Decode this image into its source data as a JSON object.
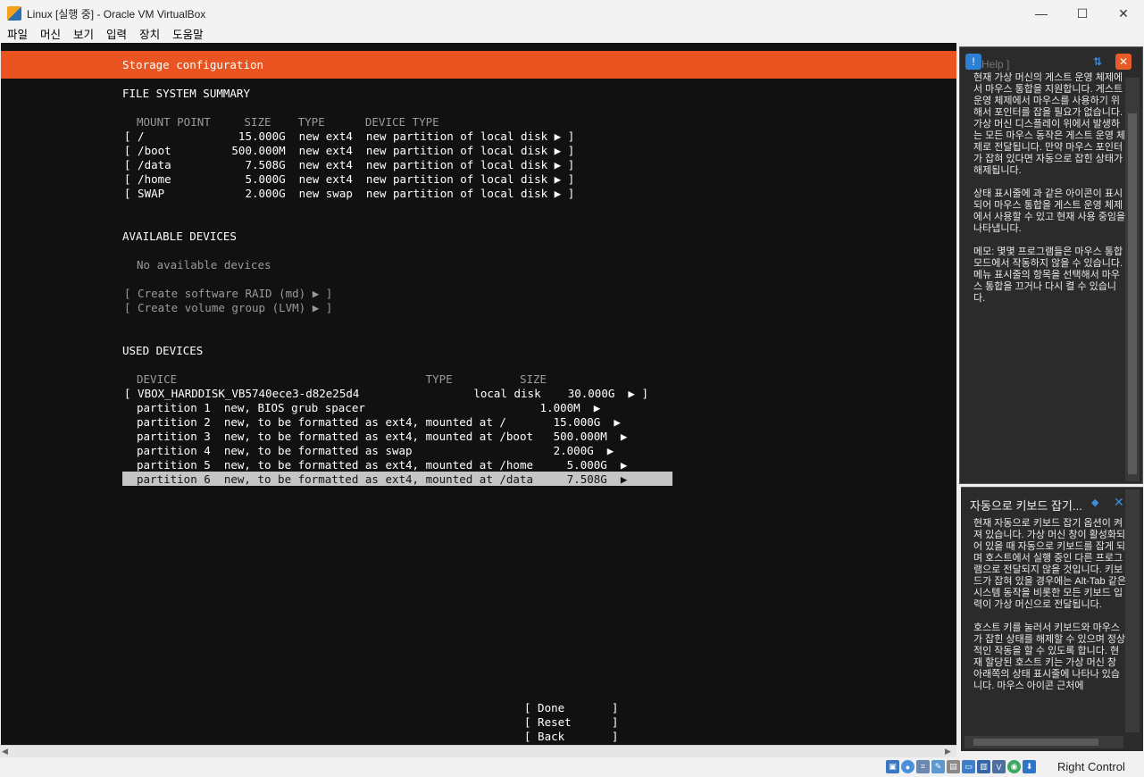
{
  "window": {
    "title": "Linux [실행 중] - Oracle VM VirtualBox",
    "min": "—",
    "max": "☐",
    "close": "✕"
  },
  "menu": [
    "파일",
    "머신",
    "보기",
    "입력",
    "장치",
    "도움말"
  ],
  "vm": {
    "header": "Storage configuration",
    "fs_summary_title": "FILE SYSTEM SUMMARY",
    "fs_header": "MOUNT POINT     SIZE    TYPE      DEVICE TYPE",
    "fs_rows": [
      "[ /              15.000G  new ext4  new partition of local disk ▶ ]",
      "[ /boot         500.000M  new ext4  new partition of local disk ▶ ]",
      "[ /data           7.508G  new ext4  new partition of local disk ▶ ]",
      "[ /home           5.000G  new ext4  new partition of local disk ▶ ]",
      "[ SWAP            2.000G  new swap  new partition of local disk ▶ ]"
    ],
    "available_title": "AVAILABLE DEVICES",
    "no_devices": "No available devices",
    "create_raid": "[ Create software RAID (md) ▶ ]",
    "create_lvm": "[ Create volume group (LVM) ▶ ]",
    "used_title": "USED DEVICES",
    "used_header": "DEVICE                                     TYPE          SIZE",
    "used_disk": "[ VBOX_HARDDISK_VB5740ece3-d82e25d4                 local disk    30.000G  ▶ ]",
    "partitions": [
      "partition 1  new, BIOS grub spacer                          1.000M  ▶",
      "partition 2  new, to be formatted as ext4, mounted at /       15.000G  ▶",
      "partition 3  new, to be formatted as ext4, mounted at /boot   500.000M  ▶",
      "partition 4  new, to be formatted as swap                     2.000G  ▶",
      "partition 5  new, to be formatted as ext4, mounted at /home     5.000G  ▶",
      "partition 6  new, to be formatted as ext4, mounted at /data     7.508G  ▶"
    ],
    "btn_done": "[ Done       ]",
    "btn_reset": "[ Reset      ]",
    "btn_back": "[ Back       ]"
  },
  "help_panel": {
    "label": "Help ]",
    "paragraphs": [
      "현재 가상 머신의 게스트 운영 체제에서 마우스 통합을 지원합니다. 게스트 운영 체제에서 마우스를 사용하기 위해서 포인터를 잡을 필요가 없습니다. 가상 머신 디스플레이 위에서 발생하는 모든 마우스 동작은 게스트 운영 체제로 전달됩니다. 만약 마우스 포인터가 잡혀 있다면 자동으로 잡힌 상태가 해제됩니다.",
      "상태 표시줄에 과 같은 아이콘이 표시되어 마우스 통합을 게스트 운영 체제에서 사용할 수 있고 현재 사용 중임을 나타냅니다.",
      "메모: 몇몇 프로그램들은 마우스 통합 모드에서 작동하지 않을 수 있습니다. 메뉴 표시줄의 항목을 선택해서 마우스 통합을 끄거나 다시 켤 수 있습니다."
    ]
  },
  "kbd_panel": {
    "title": "자동으로 키보드 잡기...",
    "paragraphs": [
      "현재 자동으로 키보드 잡기 옵션이 켜져 있습니다. 가상 머신 창이 활성화되어 있을 때 자동으로 키보드를 잡게 되며 호스트에서 실행 중인 다른 프로그램으로 전달되지 않을 것입니다. 키보드가 잡혀 있을 경우에는 Alt-Tab 같은 시스템 동작을 비롯한 모든 키보드 입력이 가상 머신으로 전달됩니다.",
      "호스트 키를 눌러서 키보드와 마우스가 잡힌 상태를 해제할 수 있으며 정상적인 작동을 할 수 있도록 합니다. 현재 할당된 호스트 키는 가상 머신 창 아래쪽의 상태 표시줄에 나타나 있습니다. 마우스 아이콘 근처에"
    ]
  },
  "status": {
    "host_key": "Right Control",
    "icons": [
      "hdd-icon",
      "optical-icon",
      "network-icon",
      "usb-icon",
      "shared-folder-icon",
      "display-icon",
      "recording-icon",
      "cpu-icon",
      "mouse-integration-icon",
      "keyboard-icon"
    ]
  }
}
